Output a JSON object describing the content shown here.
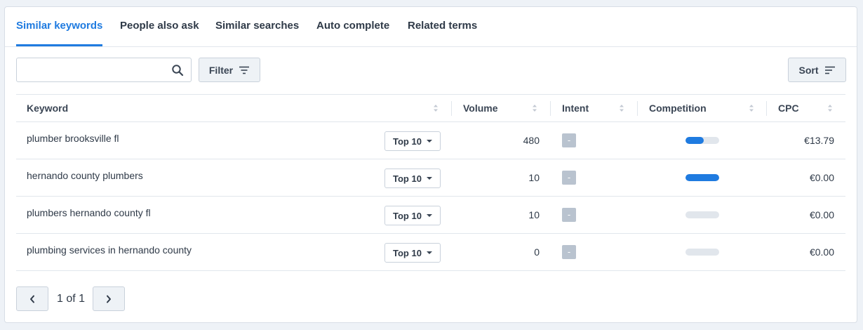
{
  "tabs": [
    {
      "label": "Similar keywords",
      "active": true
    },
    {
      "label": "People also ask",
      "active": false
    },
    {
      "label": "Similar searches",
      "active": false
    },
    {
      "label": "Auto complete",
      "active": false
    },
    {
      "label": "Related terms",
      "active": false
    }
  ],
  "toolbar": {
    "search_value": "",
    "search_placeholder": "",
    "filter_label": "Filter",
    "sort_label": "Sort"
  },
  "table": {
    "headers": {
      "keyword": "Keyword",
      "volume": "Volume",
      "intent": "Intent",
      "competition": "Competition",
      "cpc": "CPC"
    },
    "rows": [
      {
        "keyword": "plumber brooksville fl",
        "rank_filter": "Top 10",
        "volume": "480",
        "intent": "-",
        "competition": 0.55,
        "cpc": "€13.79"
      },
      {
        "keyword": "hernando county plumbers",
        "rank_filter": "Top 10",
        "volume": "10",
        "intent": "-",
        "competition": 1.0,
        "cpc": "€0.00"
      },
      {
        "keyword": "plumbers hernando county fl",
        "rank_filter": "Top 10",
        "volume": "10",
        "intent": "-",
        "competition": 0.0,
        "cpc": "€0.00"
      },
      {
        "keyword": "plumbing services in hernando county",
        "rank_filter": "Top 10",
        "volume": "0",
        "intent": "-",
        "competition": 0.0,
        "cpc": "€0.00"
      }
    ]
  },
  "pagination": {
    "text": "1 of 1"
  },
  "colors": {
    "accent": "#1f7be0",
    "intent_badge": "#b9c3cf",
    "bar_track": "#e1e6ec"
  },
  "icons": {
    "search": "search-icon",
    "filter": "filter-icon",
    "sort": "sort-icon",
    "dropdown": "caret-down-icon",
    "column_sort": "sort-arrows-icon",
    "prev": "chevron-left-icon",
    "next": "chevron-right-icon"
  }
}
